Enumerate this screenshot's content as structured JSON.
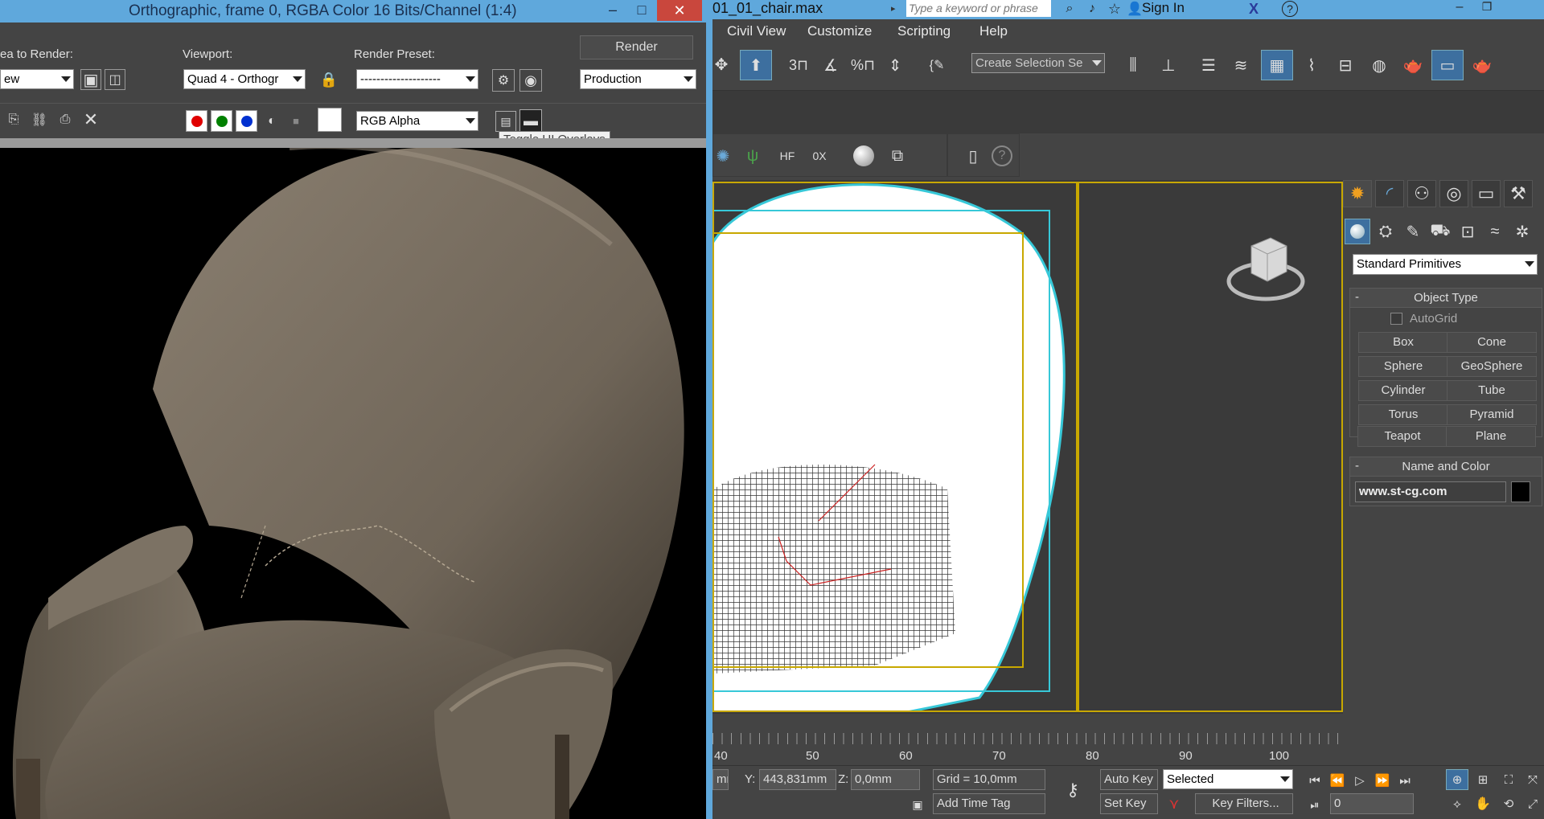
{
  "render_window": {
    "title": "Orthographic, frame 0, RGBA Color 16 Bits/Channel (1:4)",
    "area_label": "ea to Render:",
    "area_value": "ew",
    "viewport_label": "Viewport:",
    "viewport_value": "Quad 4 - Orthogr",
    "preset_label": "Render Preset:",
    "preset_value": "--------------------",
    "render_button": "Render",
    "production_value": "Production",
    "channel_value": "RGB Alpha",
    "tooltip": "Toggle UI Overlays",
    "win_minimize": "–",
    "win_maximize": "□",
    "win_close": "✕"
  },
  "max": {
    "file_title": "01_01_chair.max",
    "search_placeholder": "Type a keyword or phrase",
    "sign_in": "Sign In",
    "help_icon": "?",
    "menus": [
      "Civil View",
      "Customize",
      "Scripting",
      "Help"
    ],
    "selection_set_placeholder": "Create Selection Se",
    "command_panel": {
      "category": "Standard Primitives",
      "object_type_title": "Object Type",
      "autogrid_label": "AutoGrid",
      "buttons": [
        "Box",
        "Cone",
        "Sphere",
        "GeoSphere",
        "Cylinder",
        "Tube",
        "Torus",
        "Pyramid",
        "Teapot",
        "Plane"
      ],
      "name_color_title": "Name and Color",
      "object_name": "www.st-cg.com",
      "rollout_toggle": "-"
    },
    "timeline": {
      "ticks": [
        "40",
        "50",
        "60",
        "70",
        "80",
        "90",
        "100"
      ]
    },
    "status": {
      "x_value": "mm",
      "y_label": "Y:",
      "y_value": "443,831mm",
      "z_label": "Z:",
      "z_value": "0,0mm",
      "grid": "Grid = 10,0mm",
      "add_time_tag": "Add Time Tag",
      "auto_key": "Auto Key",
      "set_key": "Set Key",
      "selected_value": "Selected",
      "key_filters": "Key Filters...",
      "frame_value": "0"
    }
  },
  "colors": {
    "title_bar_blue": "#5fa8dc",
    "ui_gray": "#444444",
    "viewport_gray": "#3a3a3a",
    "selection_yellow": "#c8a800",
    "safe_frame_cyan": "#37c8d8"
  }
}
